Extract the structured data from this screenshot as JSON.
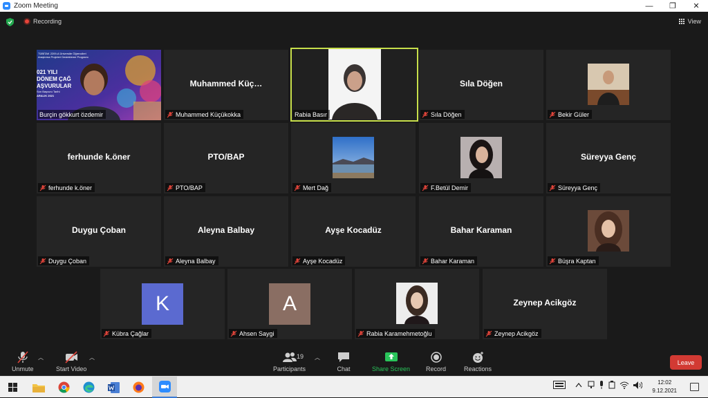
{
  "window": {
    "title": "Zoom Meeting",
    "controls": [
      "—",
      "❐",
      "✕"
    ]
  },
  "topbar": {
    "recording_label": "Recording",
    "view_label": "View"
  },
  "tiles": [
    {
      "name": "Burçin gökkurt özdemir",
      "big": "",
      "type": "video-banner"
    },
    {
      "name": "Muhammed Küçükokka",
      "big": "Muhammed  Küç…",
      "type": "text"
    },
    {
      "name": "Rabia Basır",
      "big": "",
      "type": "video-person",
      "active": true
    },
    {
      "name": "Sıla Döğen",
      "big": "Sıla Döğen",
      "type": "text"
    },
    {
      "name": "Bekir Güler",
      "big": "",
      "type": "photo-man"
    },
    {
      "name": "ferhunde k.öner",
      "big": "ferhunde k.öner",
      "type": "text"
    },
    {
      "name": "PTO/BAP",
      "big": "PTO/BAP",
      "type": "text"
    },
    {
      "name": "Mert Dağ",
      "big": "",
      "type": "photo-landscape"
    },
    {
      "name": "F.Betül Demir",
      "big": "",
      "type": "photo-woman-dark"
    },
    {
      "name": "Süreyya Genç",
      "big": "Süreyya Genç",
      "type": "text"
    },
    {
      "name": "Duygu Çoban",
      "big": "Duygu Çoban",
      "type": "text"
    },
    {
      "name": "Aleyna Balbay",
      "big": "Aleyna Balbay",
      "type": "text"
    },
    {
      "name": "Ayşe Kocadüz",
      "big": "Ayşe Kocadüz",
      "type": "text"
    },
    {
      "name": "Bahar Karaman",
      "big": "Bahar Karaman",
      "type": "text"
    },
    {
      "name": "Büşra Kaptan",
      "big": "",
      "type": "photo-woman"
    },
    {
      "name": "Kübra Çağlar",
      "big": "K",
      "type": "letter",
      "color": "#5b6ad0"
    },
    {
      "name": "Ahsen Saygi",
      "big": "A",
      "type": "letter",
      "color": "#8a6e63"
    },
    {
      "name": "Rabia Karamehmetoğlu",
      "big": "",
      "type": "photo-woman-light"
    },
    {
      "name": "Zeynep Acikgöz",
      "big": "Zeynep Acikgöz",
      "type": "text"
    }
  ],
  "banner": {
    "lines": [
      "TÜBİTAK 2209-A Üniversite Öğrencileri",
      "Araştırma Projeleri Destekleme Programı",
      "021 YILI",
      "DÖNEM ÇAĞ",
      "AŞVURULAR",
      "Son Başvuru Tarihi",
      "ARALIK 2021"
    ]
  },
  "toolbar": {
    "unmute": "Unmute",
    "start_video": "Start Video",
    "participants": "Participants",
    "participants_count": "19",
    "chat": "Chat",
    "share_screen": "Share Screen",
    "record": "Record",
    "reactions": "Reactions",
    "leave": "Leave"
  },
  "taskbar": {
    "apps": [
      "windows-start",
      "file-explorer",
      "chrome",
      "edge",
      "word",
      "firefox",
      "zoom"
    ],
    "time": "12:02",
    "date": "9.12.2021"
  },
  "colors": {
    "accent_active": "#c8e04b",
    "leave": "#d23a33",
    "share_green": "#29c45a"
  }
}
